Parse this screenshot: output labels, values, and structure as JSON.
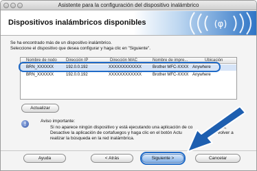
{
  "window": {
    "title": "Asistente para la configuración del dispositivo inalámbrico"
  },
  "banner": {
    "title": "Dispositivos inalámbricos disponibles"
  },
  "message": {
    "line1": "Se ha encontrado más de un dispositivo inalámbrico.",
    "line2": "Seleccione el dispositivo que desea configurar y haga clic en \"Siguiente\"."
  },
  "table": {
    "headers": [
      "Nombre de nodo",
      "Dirección IP",
      "Dirección MAC",
      "Nombre de impre...",
      "Ubicación"
    ],
    "rows": [
      {
        "node": "BRN_XXXXXX",
        "ip": "192.0.0.192",
        "mac": "XXXXXXXXXXXX",
        "printer": "Brother MFC-XXXX",
        "location": "Anywhere"
      },
      {
        "node": "BRN_XXXXXX",
        "ip": "192.0.0.192",
        "mac": "XXXXXXXXXXXX",
        "printer": "Brother MFC-XXXX",
        "location": "Anywhere"
      }
    ]
  },
  "buttons": {
    "refresh": "Actualizar",
    "help": "Ayuda",
    "back": "< Atrás",
    "next": "Siguiente >",
    "cancel": "Cancelar"
  },
  "notice": {
    "title": "Aviso importante:",
    "line1": "Si no aparece ningún dispositivo y está ejecutando una aplicación de co",
    "line1b": "os,",
    "line2": "Desactive la aplicación de cortafuegos y haga clic en el botón Actu",
    "line2b": "volver a",
    "line3": "realizar la búsqueda en la red inalámbrica."
  },
  "colors": {
    "highlight": "#1f6ac7",
    "arrow": "#1e5fb0"
  }
}
